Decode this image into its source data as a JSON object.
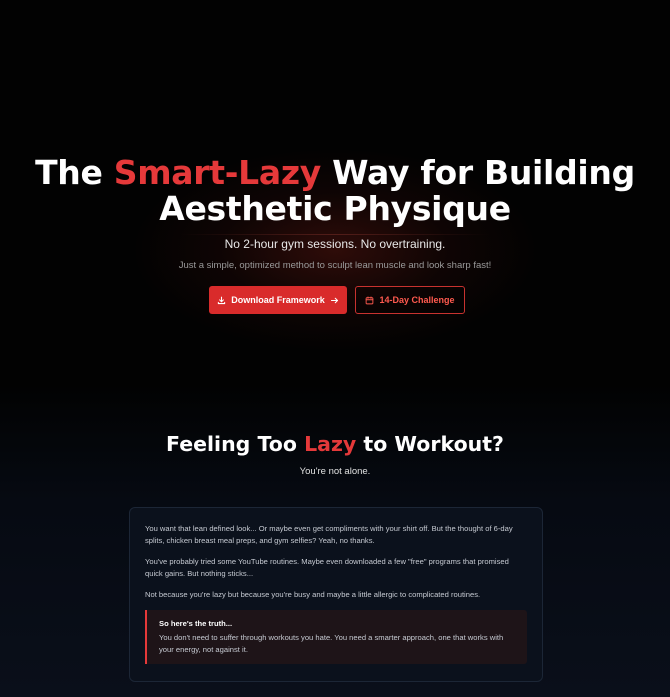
{
  "colors": {
    "accent": "#e5393a",
    "primary_button": "#d92b2b",
    "background": "#000000"
  },
  "hero": {
    "title_pre": "The ",
    "title_accent": "Smart-Lazy",
    "title_line1_post": " Way for Building",
    "title_line2": "Aesthetic Physique",
    "subtitle": "No 2-hour gym sessions. No overtraining.",
    "description": "Just a simple, optimized method to sculpt lean muscle and look sharp fast!",
    "primary_button": {
      "label": "Download Framework",
      "icon": "download-icon",
      "trailing_icon": "arrow-right-icon"
    },
    "secondary_button": {
      "label": "14-Day Challenge",
      "icon": "calendar-icon"
    }
  },
  "lazy_section": {
    "title_pre": "Feeling Too ",
    "title_accent": "Lazy",
    "title_post": " to Workout?",
    "subtitle": "You're not alone.",
    "paragraphs": [
      "You want that lean defined look... Or maybe even get compliments with your shirt off. But the thought of 6-day splits, chicken breast meal preps, and gym selfies? Yeah, no thanks.",
      "You've probably tried some YouTube routines. Maybe even downloaded a few \"free\" programs that promised quick gains. But nothing sticks...",
      "Not because you're lazy but because you're busy and maybe a little allergic to complicated routines."
    ],
    "callout": {
      "title": "So here's the truth...",
      "body": "You don't need to suffer through workouts you hate. You need a smarter approach, one that works with your energy, not against it."
    }
  }
}
